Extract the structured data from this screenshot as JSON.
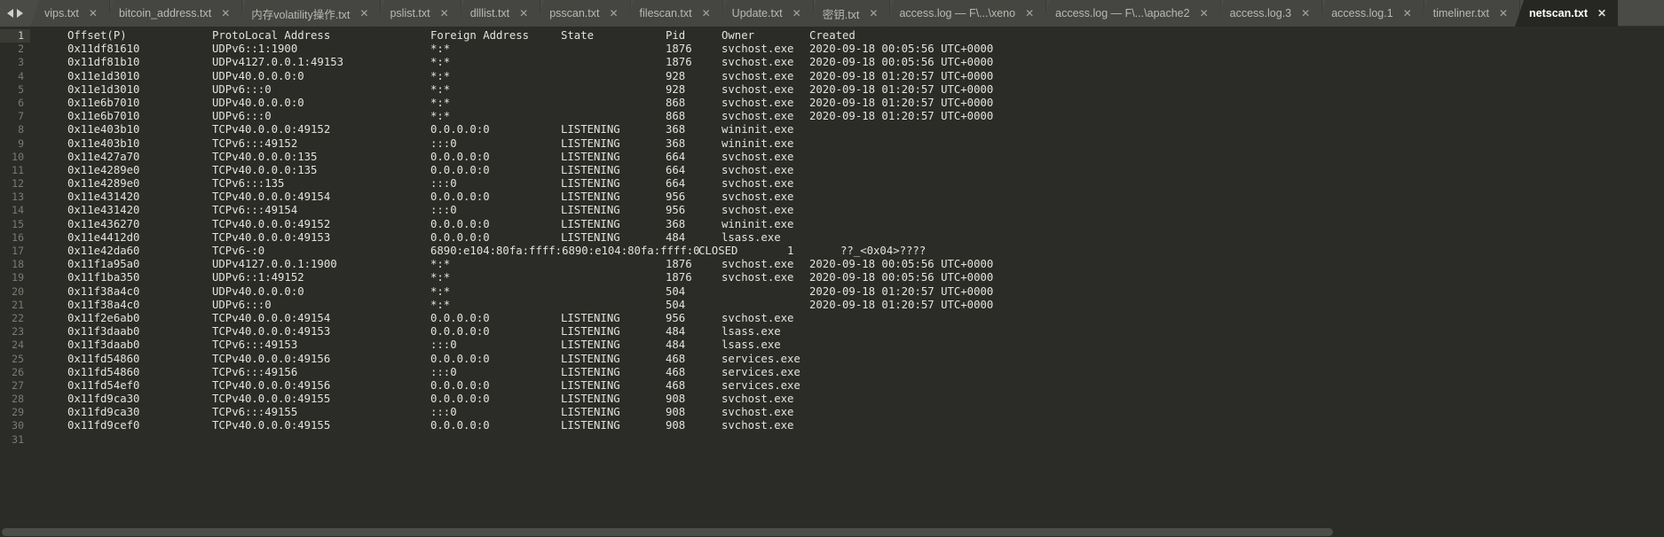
{
  "window": {
    "title": "netscan.txt",
    "background_color": "#2b2b28",
    "tabbar_color": "#4a4a46",
    "text_color": "#e4e4dc",
    "gutter_color": "#7b7b74"
  },
  "tabbar": {
    "nav_prev_icon": "arrow-left-icon",
    "nav_next_icon": "arrow-right-icon",
    "close_glyph": "✕",
    "tabs": [
      {
        "label": "vips.txt",
        "active": false
      },
      {
        "label": "bitcoin_address.txt",
        "active": false
      },
      {
        "label": "内存volatility操作.txt",
        "active": false
      },
      {
        "label": "pslist.txt",
        "active": false
      },
      {
        "label": "dlllist.txt",
        "active": false
      },
      {
        "label": "psscan.txt",
        "active": false
      },
      {
        "label": "filescan.txt",
        "active": false
      },
      {
        "label": "Update.txt",
        "active": false
      },
      {
        "label": "密钥.txt",
        "active": false
      },
      {
        "label": "access.log — F\\...\\xeno",
        "active": false
      },
      {
        "label": "access.log — F\\...\\apache2",
        "active": false
      },
      {
        "label": "access.log.3",
        "active": false
      },
      {
        "label": "access.log.1",
        "active": false
      },
      {
        "label": "timeliner.txt",
        "active": false
      },
      {
        "label": "netscan.txt",
        "active": true
      }
    ]
  },
  "editor": {
    "total_lines": 31,
    "current_line": 1,
    "columns": [
      "Offset(P)",
      "Proto",
      "Local Address",
      "Foreign Address",
      "State",
      "Pid",
      "Owner",
      "Created"
    ],
    "lines": [
      {
        "n": 1,
        "offset": "Offset(P)",
        "proto": "Proto",
        "local": "Local Address",
        "foreign": "Foreign Address",
        "state": "State",
        "pid": "Pid",
        "owner": "Owner",
        "created": "Created"
      },
      {
        "n": 2,
        "offset": "0x11df81610",
        "proto": "UDPv6",
        "local": "::1:1900",
        "foreign": "*:*",
        "state": "",
        "pid": "1876",
        "owner": "svchost.exe",
        "created": "2020-09-18 00:05:56 UTC+0000"
      },
      {
        "n": 3,
        "offset": "0x11df81b10",
        "proto": "UDPv4",
        "local": "127.0.0.1:49153",
        "foreign": "*:*",
        "state": "",
        "pid": "1876",
        "owner": "svchost.exe",
        "created": "2020-09-18 00:05:56 UTC+0000"
      },
      {
        "n": 4,
        "offset": "0x11e1d3010",
        "proto": "UDPv4",
        "local": "0.0.0.0:0",
        "foreign": "*:*",
        "state": "",
        "pid": "928",
        "owner": "svchost.exe",
        "created": "2020-09-18 01:20:57 UTC+0000"
      },
      {
        "n": 5,
        "offset": "0x11e1d3010",
        "proto": "UDPv6",
        "local": ":::0",
        "foreign": "*:*",
        "state": "",
        "pid": "928",
        "owner": "svchost.exe",
        "created": "2020-09-18 01:20:57 UTC+0000"
      },
      {
        "n": 6,
        "offset": "0x11e6b7010",
        "proto": "UDPv4",
        "local": "0.0.0.0:0",
        "foreign": "*:*",
        "state": "",
        "pid": "868",
        "owner": "svchost.exe",
        "created": "2020-09-18 01:20:57 UTC+0000"
      },
      {
        "n": 7,
        "offset": "0x11e6b7010",
        "proto": "UDPv6",
        "local": ":::0",
        "foreign": "*:*",
        "state": "",
        "pid": "868",
        "owner": "svchost.exe",
        "created": "2020-09-18 01:20:57 UTC+0000"
      },
      {
        "n": 8,
        "offset": "0x11e403b10",
        "proto": "TCPv4",
        "local": "0.0.0.0:49152",
        "foreign": "0.0.0.0:0",
        "state": "LISTENING",
        "pid": "368",
        "owner": "wininit.exe",
        "created": ""
      },
      {
        "n": 9,
        "offset": "0x11e403b10",
        "proto": "TCPv6",
        "local": ":::49152",
        "foreign": ":::0",
        "state": "LISTENING",
        "pid": "368",
        "owner": "wininit.exe",
        "created": ""
      },
      {
        "n": 10,
        "offset": "0x11e427a70",
        "proto": "TCPv4",
        "local": "0.0.0.0:135",
        "foreign": "0.0.0.0:0",
        "state": "LISTENING",
        "pid": "664",
        "owner": "svchost.exe",
        "created": ""
      },
      {
        "n": 11,
        "offset": "0x11e4289e0",
        "proto": "TCPv4",
        "local": "0.0.0.0:135",
        "foreign": "0.0.0.0:0",
        "state": "LISTENING",
        "pid": "664",
        "owner": "svchost.exe",
        "created": ""
      },
      {
        "n": 12,
        "offset": "0x11e4289e0",
        "proto": "TCPv6",
        "local": ":::135",
        "foreign": ":::0",
        "state": "LISTENING",
        "pid": "664",
        "owner": "svchost.exe",
        "created": ""
      },
      {
        "n": 13,
        "offset": "0x11e431420",
        "proto": "TCPv4",
        "local": "0.0.0.0:49154",
        "foreign": "0.0.0.0:0",
        "state": "LISTENING",
        "pid": "956",
        "owner": "svchost.exe",
        "created": ""
      },
      {
        "n": 14,
        "offset": "0x11e431420",
        "proto": "TCPv6",
        "local": ":::49154",
        "foreign": ":::0",
        "state": "LISTENING",
        "pid": "956",
        "owner": "svchost.exe",
        "created": ""
      },
      {
        "n": 15,
        "offset": "0x11e436270",
        "proto": "TCPv4",
        "local": "0.0.0.0:49152",
        "foreign": "0.0.0.0:0",
        "state": "LISTENING",
        "pid": "368",
        "owner": "wininit.exe",
        "created": ""
      },
      {
        "n": 16,
        "offset": "0x11e4412d0",
        "proto": "TCPv4",
        "local": "0.0.0.0:49153",
        "foreign": "0.0.0.0:0",
        "state": "LISTENING",
        "pid": "484",
        "owner": "lsass.exe",
        "created": ""
      },
      {
        "n": 17,
        "offset": "0x11e42da60",
        "proto": "TCPv6",
        "local": "-:0",
        "foreign": "6890:e104:80fa:ffff:6890:e104:80fa:ffff:0",
        "state": "CLOSED",
        "pid": "1",
        "owner": "??_<0x04>????",
        "created": ""
      },
      {
        "n": 18,
        "offset": "0x11f1a95a0",
        "proto": "UDPv4",
        "local": "127.0.0.1:1900",
        "foreign": "*:*",
        "state": "",
        "pid": "1876",
        "owner": "svchost.exe",
        "created": "2020-09-18 00:05:56 UTC+0000"
      },
      {
        "n": 19,
        "offset": "0x11f1ba350",
        "proto": "UDPv6",
        "local": "::1:49152",
        "foreign": "*:*",
        "state": "",
        "pid": "1876",
        "owner": "svchost.exe",
        "created": "2020-09-18 00:05:56 UTC+0000"
      },
      {
        "n": 20,
        "offset": "0x11f38a4c0",
        "proto": "UDPv4",
        "local": "0.0.0.0:0",
        "foreign": "*:*",
        "state": "",
        "pid": "504",
        "owner": "",
        "created": "2020-09-18 01:20:57 UTC+0000"
      },
      {
        "n": 21,
        "offset": "0x11f38a4c0",
        "proto": "UDPv6",
        "local": ":::0",
        "foreign": "*:*",
        "state": "",
        "pid": "504",
        "owner": "",
        "created": "2020-09-18 01:20:57 UTC+0000"
      },
      {
        "n": 22,
        "offset": "0x11f2e6ab0",
        "proto": "TCPv4",
        "local": "0.0.0.0:49154",
        "foreign": "0.0.0.0:0",
        "state": "LISTENING",
        "pid": "956",
        "owner": "svchost.exe",
        "created": ""
      },
      {
        "n": 23,
        "offset": "0x11f3daab0",
        "proto": "TCPv4",
        "local": "0.0.0.0:49153",
        "foreign": "0.0.0.0:0",
        "state": "LISTENING",
        "pid": "484",
        "owner": "lsass.exe",
        "created": ""
      },
      {
        "n": 24,
        "offset": "0x11f3daab0",
        "proto": "TCPv6",
        "local": ":::49153",
        "foreign": ":::0",
        "state": "LISTENING",
        "pid": "484",
        "owner": "lsass.exe",
        "created": ""
      },
      {
        "n": 25,
        "offset": "0x11fd54860",
        "proto": "TCPv4",
        "local": "0.0.0.0:49156",
        "foreign": "0.0.0.0:0",
        "state": "LISTENING",
        "pid": "468",
        "owner": "services.exe",
        "created": ""
      },
      {
        "n": 26,
        "offset": "0x11fd54860",
        "proto": "TCPv6",
        "local": ":::49156",
        "foreign": ":::0",
        "state": "LISTENING",
        "pid": "468",
        "owner": "services.exe",
        "created": ""
      },
      {
        "n": 27,
        "offset": "0x11fd54ef0",
        "proto": "TCPv4",
        "local": "0.0.0.0:49156",
        "foreign": "0.0.0.0:0",
        "state": "LISTENING",
        "pid": "468",
        "owner": "services.exe",
        "created": ""
      },
      {
        "n": 28,
        "offset": "0x11fd9ca30",
        "proto": "TCPv4",
        "local": "0.0.0.0:49155",
        "foreign": "0.0.0.0:0",
        "state": "LISTENING",
        "pid": "908",
        "owner": "svchost.exe",
        "created": ""
      },
      {
        "n": 29,
        "offset": "0x11fd9ca30",
        "proto": "TCPv6",
        "local": ":::49155",
        "foreign": ":::0",
        "state": "LISTENING",
        "pid": "908",
        "owner": "svchost.exe",
        "created": ""
      },
      {
        "n": 30,
        "offset": "0x11fd9cef0",
        "proto": "TCPv4",
        "local": "0.0.0.0:49155",
        "foreign": "0.0.0.0:0",
        "state": "LISTENING",
        "pid": "908",
        "owner": "svchost.exe",
        "created": ""
      },
      {
        "n": 31,
        "offset": "",
        "proto": "",
        "local": "",
        "foreign": "",
        "state": "",
        "pid": "",
        "owner": "",
        "created": ""
      }
    ]
  }
}
